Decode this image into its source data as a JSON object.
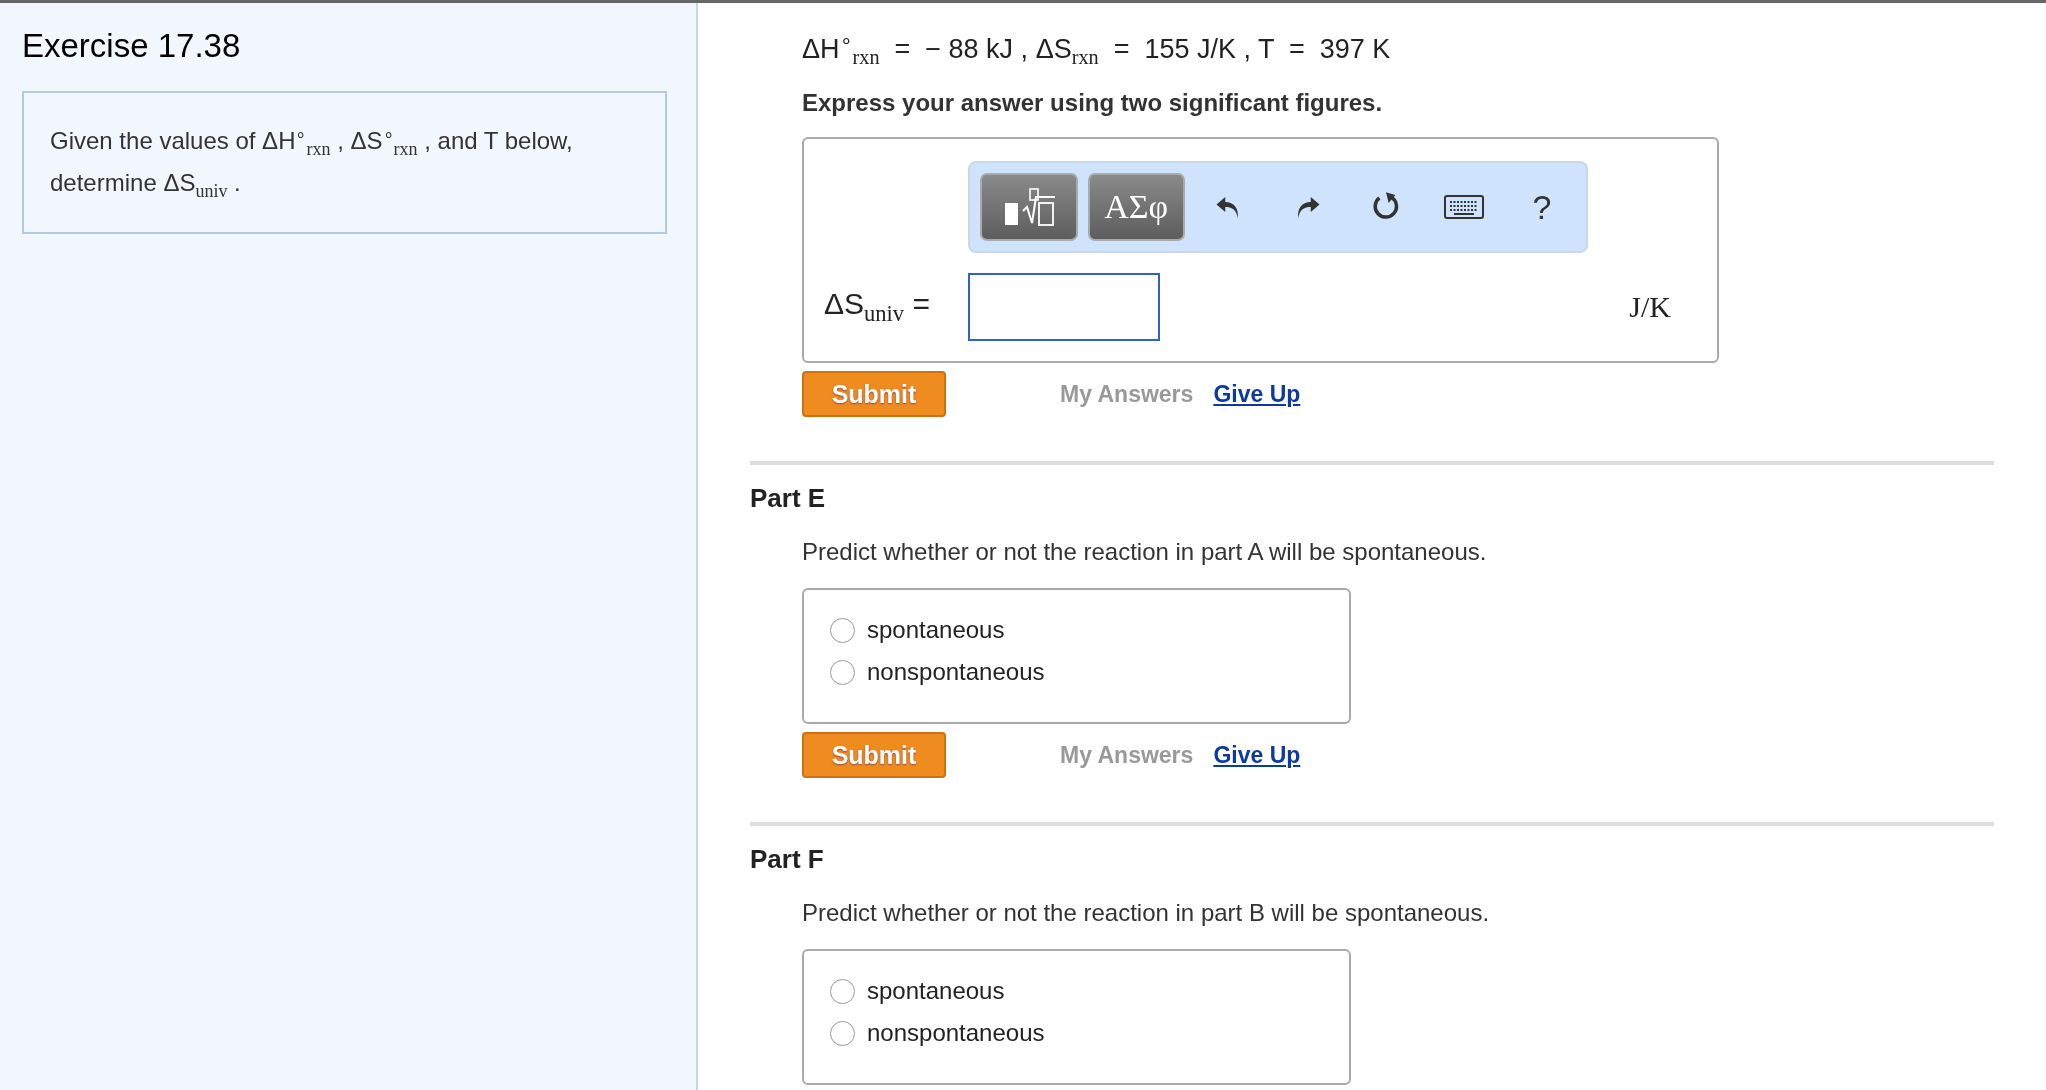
{
  "exercise": {
    "title": "Exercise 17.38",
    "prompt": "Given the values of ΔH$^{∘}$$_{rxn}$ , ΔS$^{∘}$$_{rxn}$ , and T below, determine ΔS$_{univ}$ ."
  },
  "part_d": {
    "given": "ΔH$^{∘}$$_{rxn}$  =  − 88 kJ , ΔS$_{rxn}$  =  155 J/K , T  =  397 K",
    "instruction": "Express your answer using two significant figures.",
    "toolbar": {
      "symbols": "ΑΣφ",
      "help": "?"
    },
    "answer": {
      "label": "ΔS$_{univ}$ =",
      "unit": "J/K"
    },
    "submit": "Submit",
    "my_answers": {
      "label": "My Answers",
      "disabled": true
    },
    "give_up": "Give Up"
  },
  "parts": [
    {
      "title": "Part E",
      "prompt": "Predict whether or not the reaction in part A will be spontaneous.",
      "options": [
        {
          "label": "spontaneous",
          "selected": false
        },
        {
          "label": "nonspontaneous",
          "selected": false
        }
      ],
      "submit": "Submit",
      "my_answers": {
        "label": "My Answers",
        "disabled": true
      },
      "give_up": "Give Up"
    },
    {
      "title": "Part F",
      "prompt": "Predict whether or not the reaction in part B will be spontaneous.",
      "options": [
        {
          "label": "spontaneous",
          "selected": false
        },
        {
          "label": "nonspontaneous",
          "selected": false
        }
      ]
    }
  ]
}
